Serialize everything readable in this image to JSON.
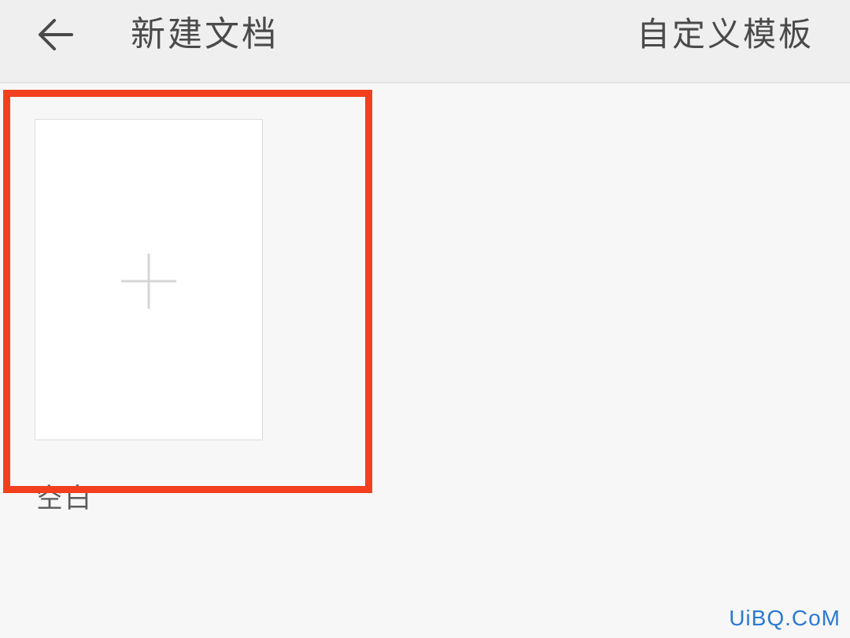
{
  "header": {
    "back_icon": "arrow-left-icon",
    "title": "新建文档",
    "custom_template_label": "自定义模板"
  },
  "templates": [
    {
      "icon": "plus-icon",
      "label": "空白"
    }
  ],
  "highlight": {
    "color": "#f2401e"
  },
  "watermark": {
    "text": "UiBQ.CoM",
    "color": "#2a7ad4"
  }
}
